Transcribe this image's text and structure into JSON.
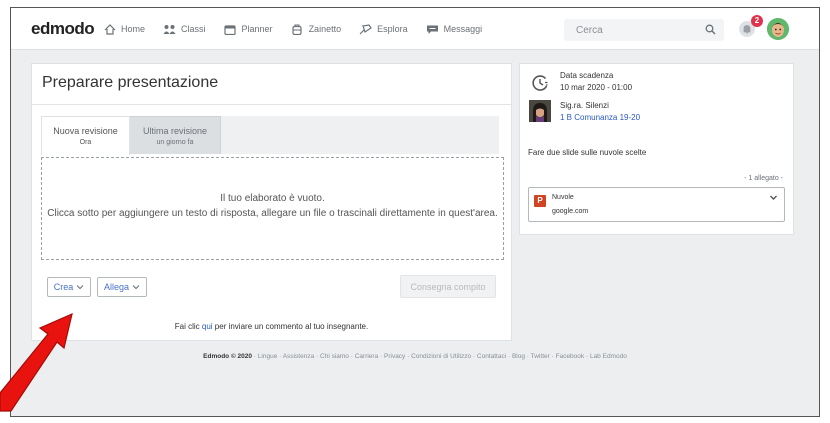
{
  "topbar": {
    "logo": "edmodo",
    "nav": [
      {
        "label": "Home",
        "icon": "home-icon"
      },
      {
        "label": "Classi",
        "icon": "classes-icon"
      },
      {
        "label": "Planner",
        "icon": "planner-icon"
      },
      {
        "label": "Zainetto",
        "icon": "backpack-icon"
      },
      {
        "label": "Esplora",
        "icon": "explore-icon"
      },
      {
        "label": "Messaggi",
        "icon": "messages-icon"
      }
    ],
    "search_placeholder": "Cerca",
    "notification_count": "2"
  },
  "assignment": {
    "title": "Preparare presentazione",
    "tabs": [
      {
        "label": "Nuova revisione",
        "sub": "Ora"
      },
      {
        "label": "Ultima revisione",
        "sub": "un giorno fa"
      }
    ],
    "empty_line1": "Il tuo elaborato è vuoto.",
    "empty_line2": "Clicca sotto per aggiungere un testo di risposta, allegare un file o trascinali direttamente in quest'area.",
    "create_label": "Crea",
    "attach_label": "Allega",
    "submit_label": "Consegna compito",
    "comment_prefix": "Fai clic",
    "comment_link": "qui",
    "comment_suffix": "per inviare un commento al tuo insegnante."
  },
  "details": {
    "due_label": "Data scadenza",
    "due_date": "10 mar 2020 - 01:00",
    "teacher_name": "Sig.ra. Silenzi",
    "class_name": "1 B Comunanza 19-20",
    "description": "Fare due slide sulle nuvole scelte",
    "attachments_count": "- 1 allegato -",
    "attachment": {
      "icon_letter": "P",
      "name": "Nuvole",
      "source": "google.com"
    }
  },
  "footer": {
    "brand": "Edmodo © 2020",
    "links": [
      "Lingue",
      "Assistenza",
      "Chi siamo",
      "Carriera",
      "Privacy",
      "Condizioni di Utilizzo",
      "Contattaci",
      "Blog",
      "Twitter",
      "Facebook",
      "Lab Edmodo"
    ]
  },
  "colors": {
    "accent": "#2b58c4",
    "badge": "#e0334b",
    "annotation_arrow": "#e8130e",
    "ppt": "#d04423"
  }
}
